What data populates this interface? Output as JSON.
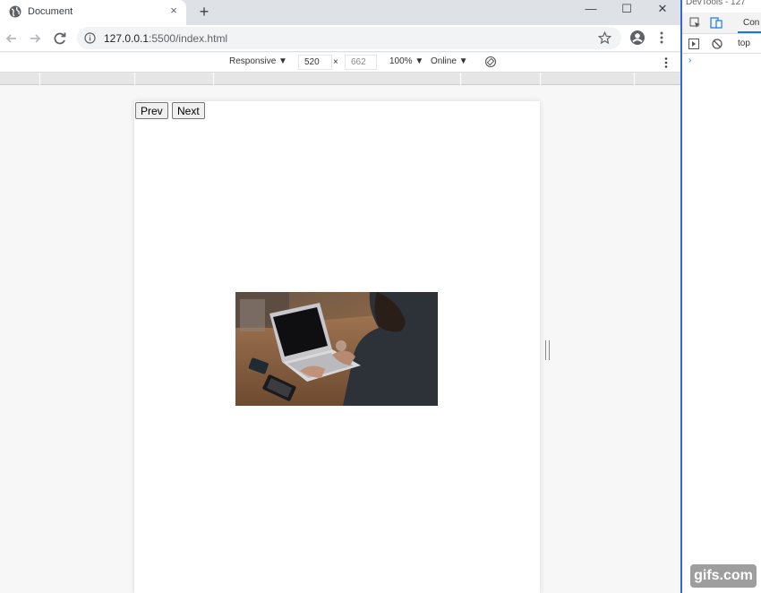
{
  "tab": {
    "title": "Document",
    "close_glyph": "×",
    "new_tab_glyph": "+"
  },
  "window": {
    "minimize_glyph": "—",
    "maximize_glyph": "☐",
    "close_glyph": "✕"
  },
  "address": {
    "host": "127.0.0.1",
    "path": ":5500/index.html"
  },
  "device_toolbar": {
    "device": "Responsive ▼",
    "width": "520",
    "times": "×",
    "height": "662",
    "zoom": "100% ▼",
    "network": "Online ▼"
  },
  "page": {
    "prev_label": "Prev",
    "next_label": "Next"
  },
  "devtools": {
    "title": "DevTools - 127",
    "tab_label": "Con",
    "context": "top",
    "prompt": "›"
  },
  "watermark": "gifs.com",
  "icons": {
    "favicon": "globe-icon",
    "back": "back-arrow-icon",
    "forward": "forward-arrow-icon",
    "reload": "reload-icon",
    "info": "info-icon",
    "bookmark": "star-icon",
    "profile": "profile-icon",
    "menu": "kebab-menu-icon",
    "rotate": "rotate-icon"
  },
  "colors": {
    "devtools_accent": "#3367d6",
    "tab_bg": "#ffffff",
    "tabstrip_bg": "#dee1e6"
  }
}
